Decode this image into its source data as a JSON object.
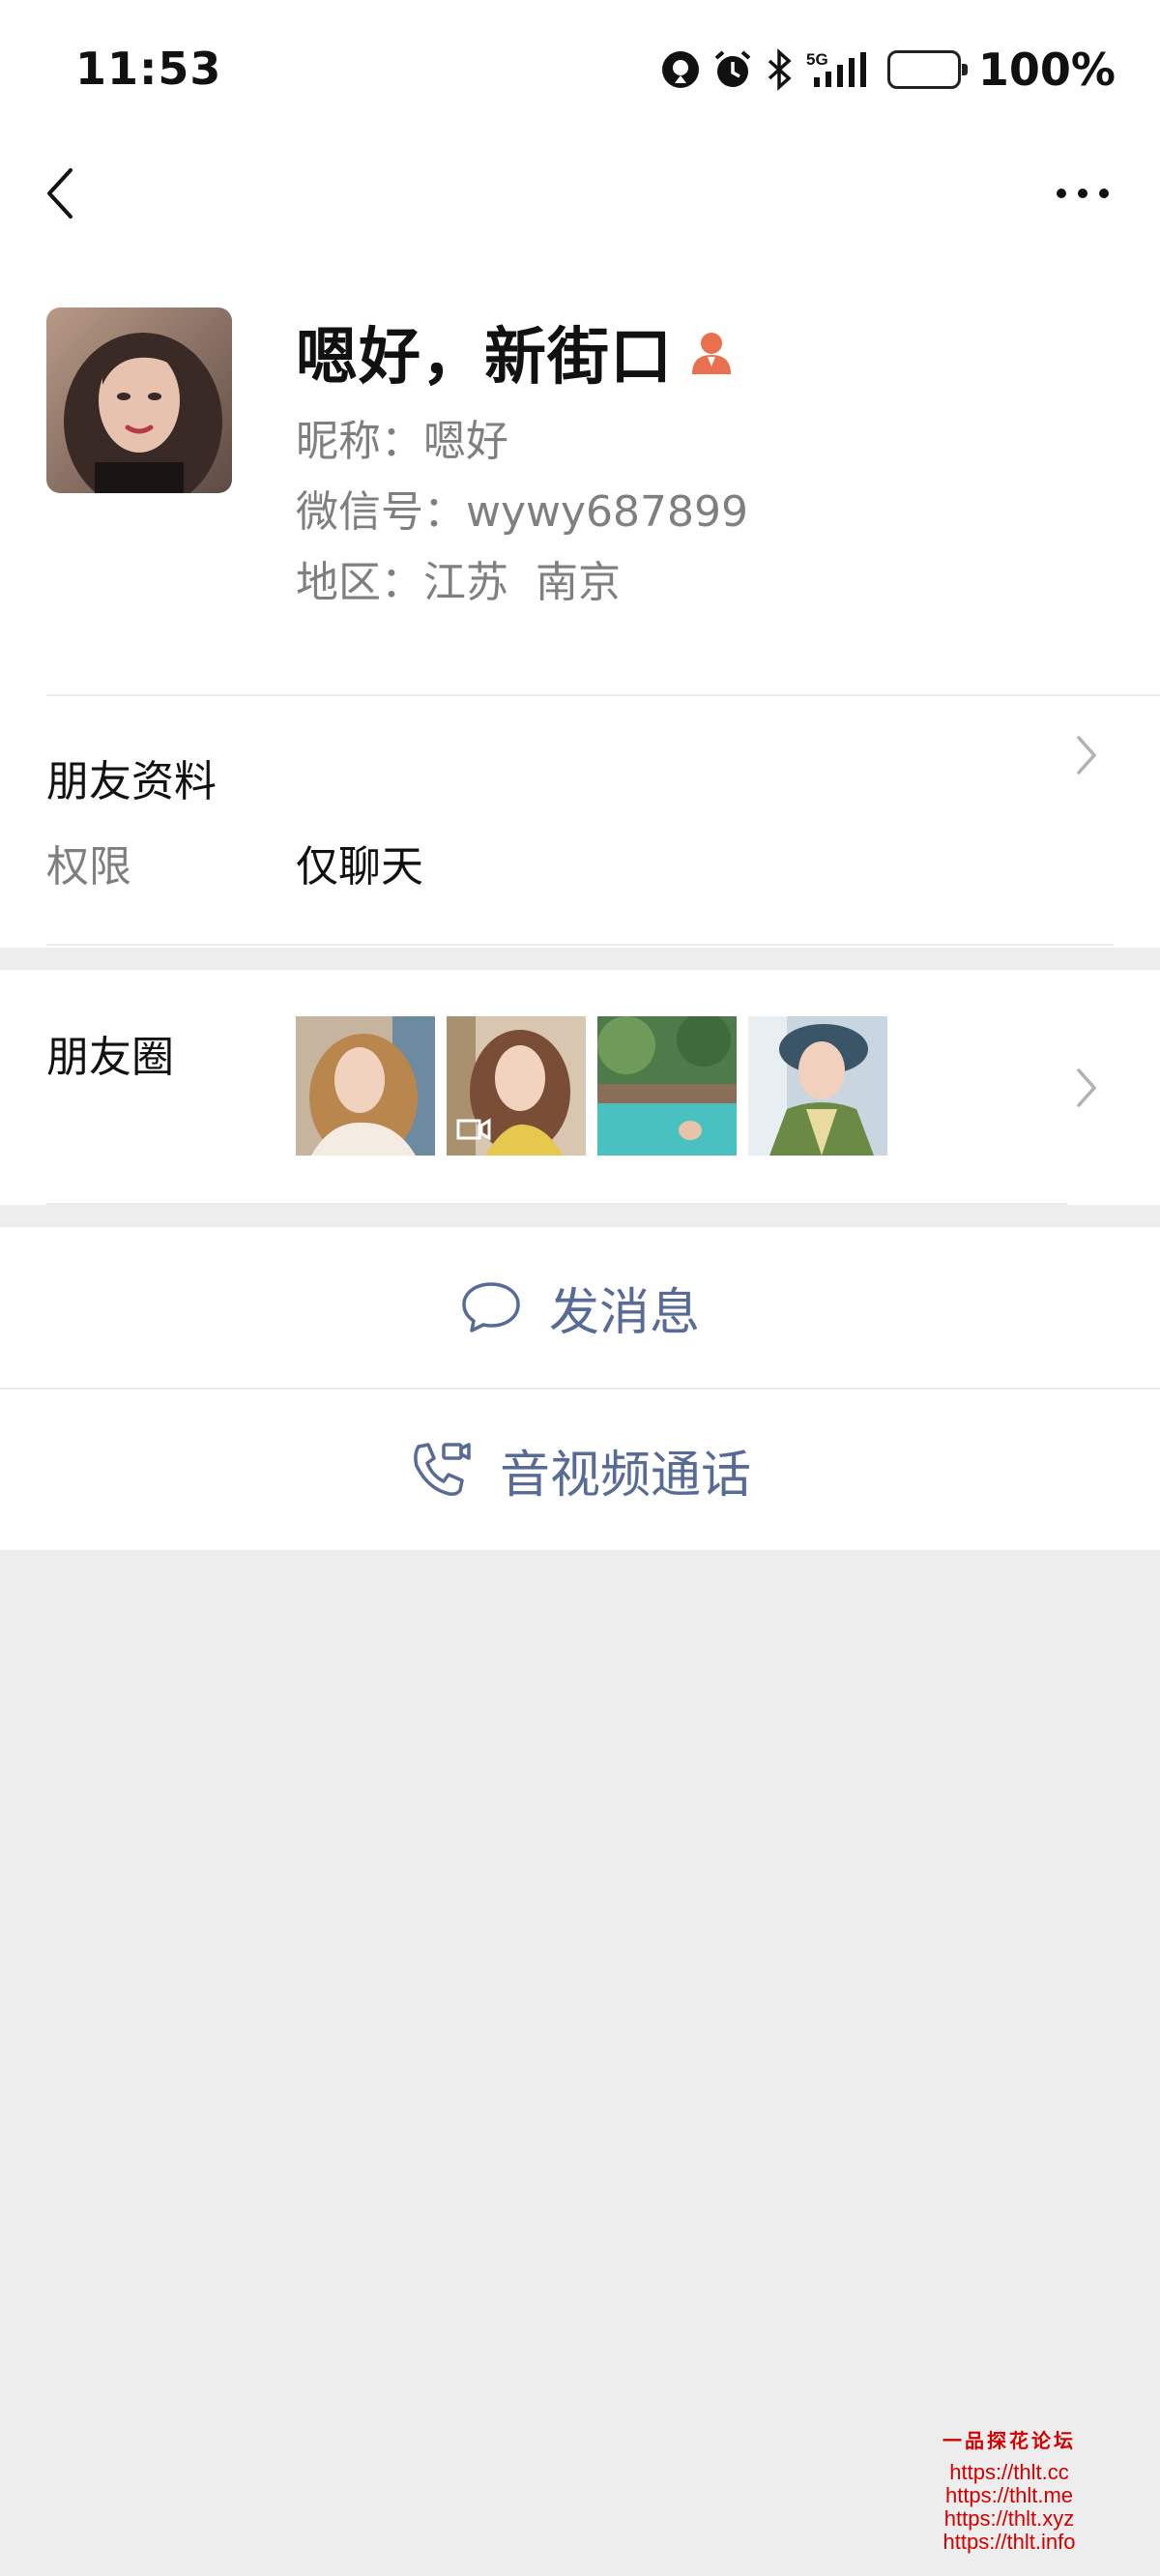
{
  "status_bar": {
    "time": "11:53",
    "network": "5G",
    "battery_percent": "100%",
    "battery_level": 1.0,
    "battery_color": "#f5c542"
  },
  "nav": {
    "back_icon": "chevron-left-icon",
    "more_icon": "ellipsis-icon"
  },
  "profile": {
    "display_name": "嗯好，新街口",
    "nickname_label": "昵称：",
    "nickname": "嗯好",
    "wechat_id_label": "微信号：",
    "wechat_id": "wywy687899",
    "region_label": "地区：",
    "region": "江苏  南京",
    "badge_icon": "female-user-icon",
    "badge_color": "#e9704f"
  },
  "friend_info": {
    "title": "朋友资料",
    "permission_label": "权限",
    "permission_value": "仅聊天"
  },
  "moments": {
    "label": "朋友圈",
    "thumbnails": [
      "moment-photo-1",
      "moment-video-2",
      "moment-photo-3",
      "moment-photo-4"
    ]
  },
  "actions": {
    "send_message": "发消息",
    "video_call": "音视频通话",
    "accent_color": "#576b95"
  },
  "watermark": {
    "title": "一品探花论坛",
    "links": [
      "https://thlt.cc",
      "https://thlt.me",
      "https://thlt.xyz",
      "https://thlt.info"
    ]
  }
}
